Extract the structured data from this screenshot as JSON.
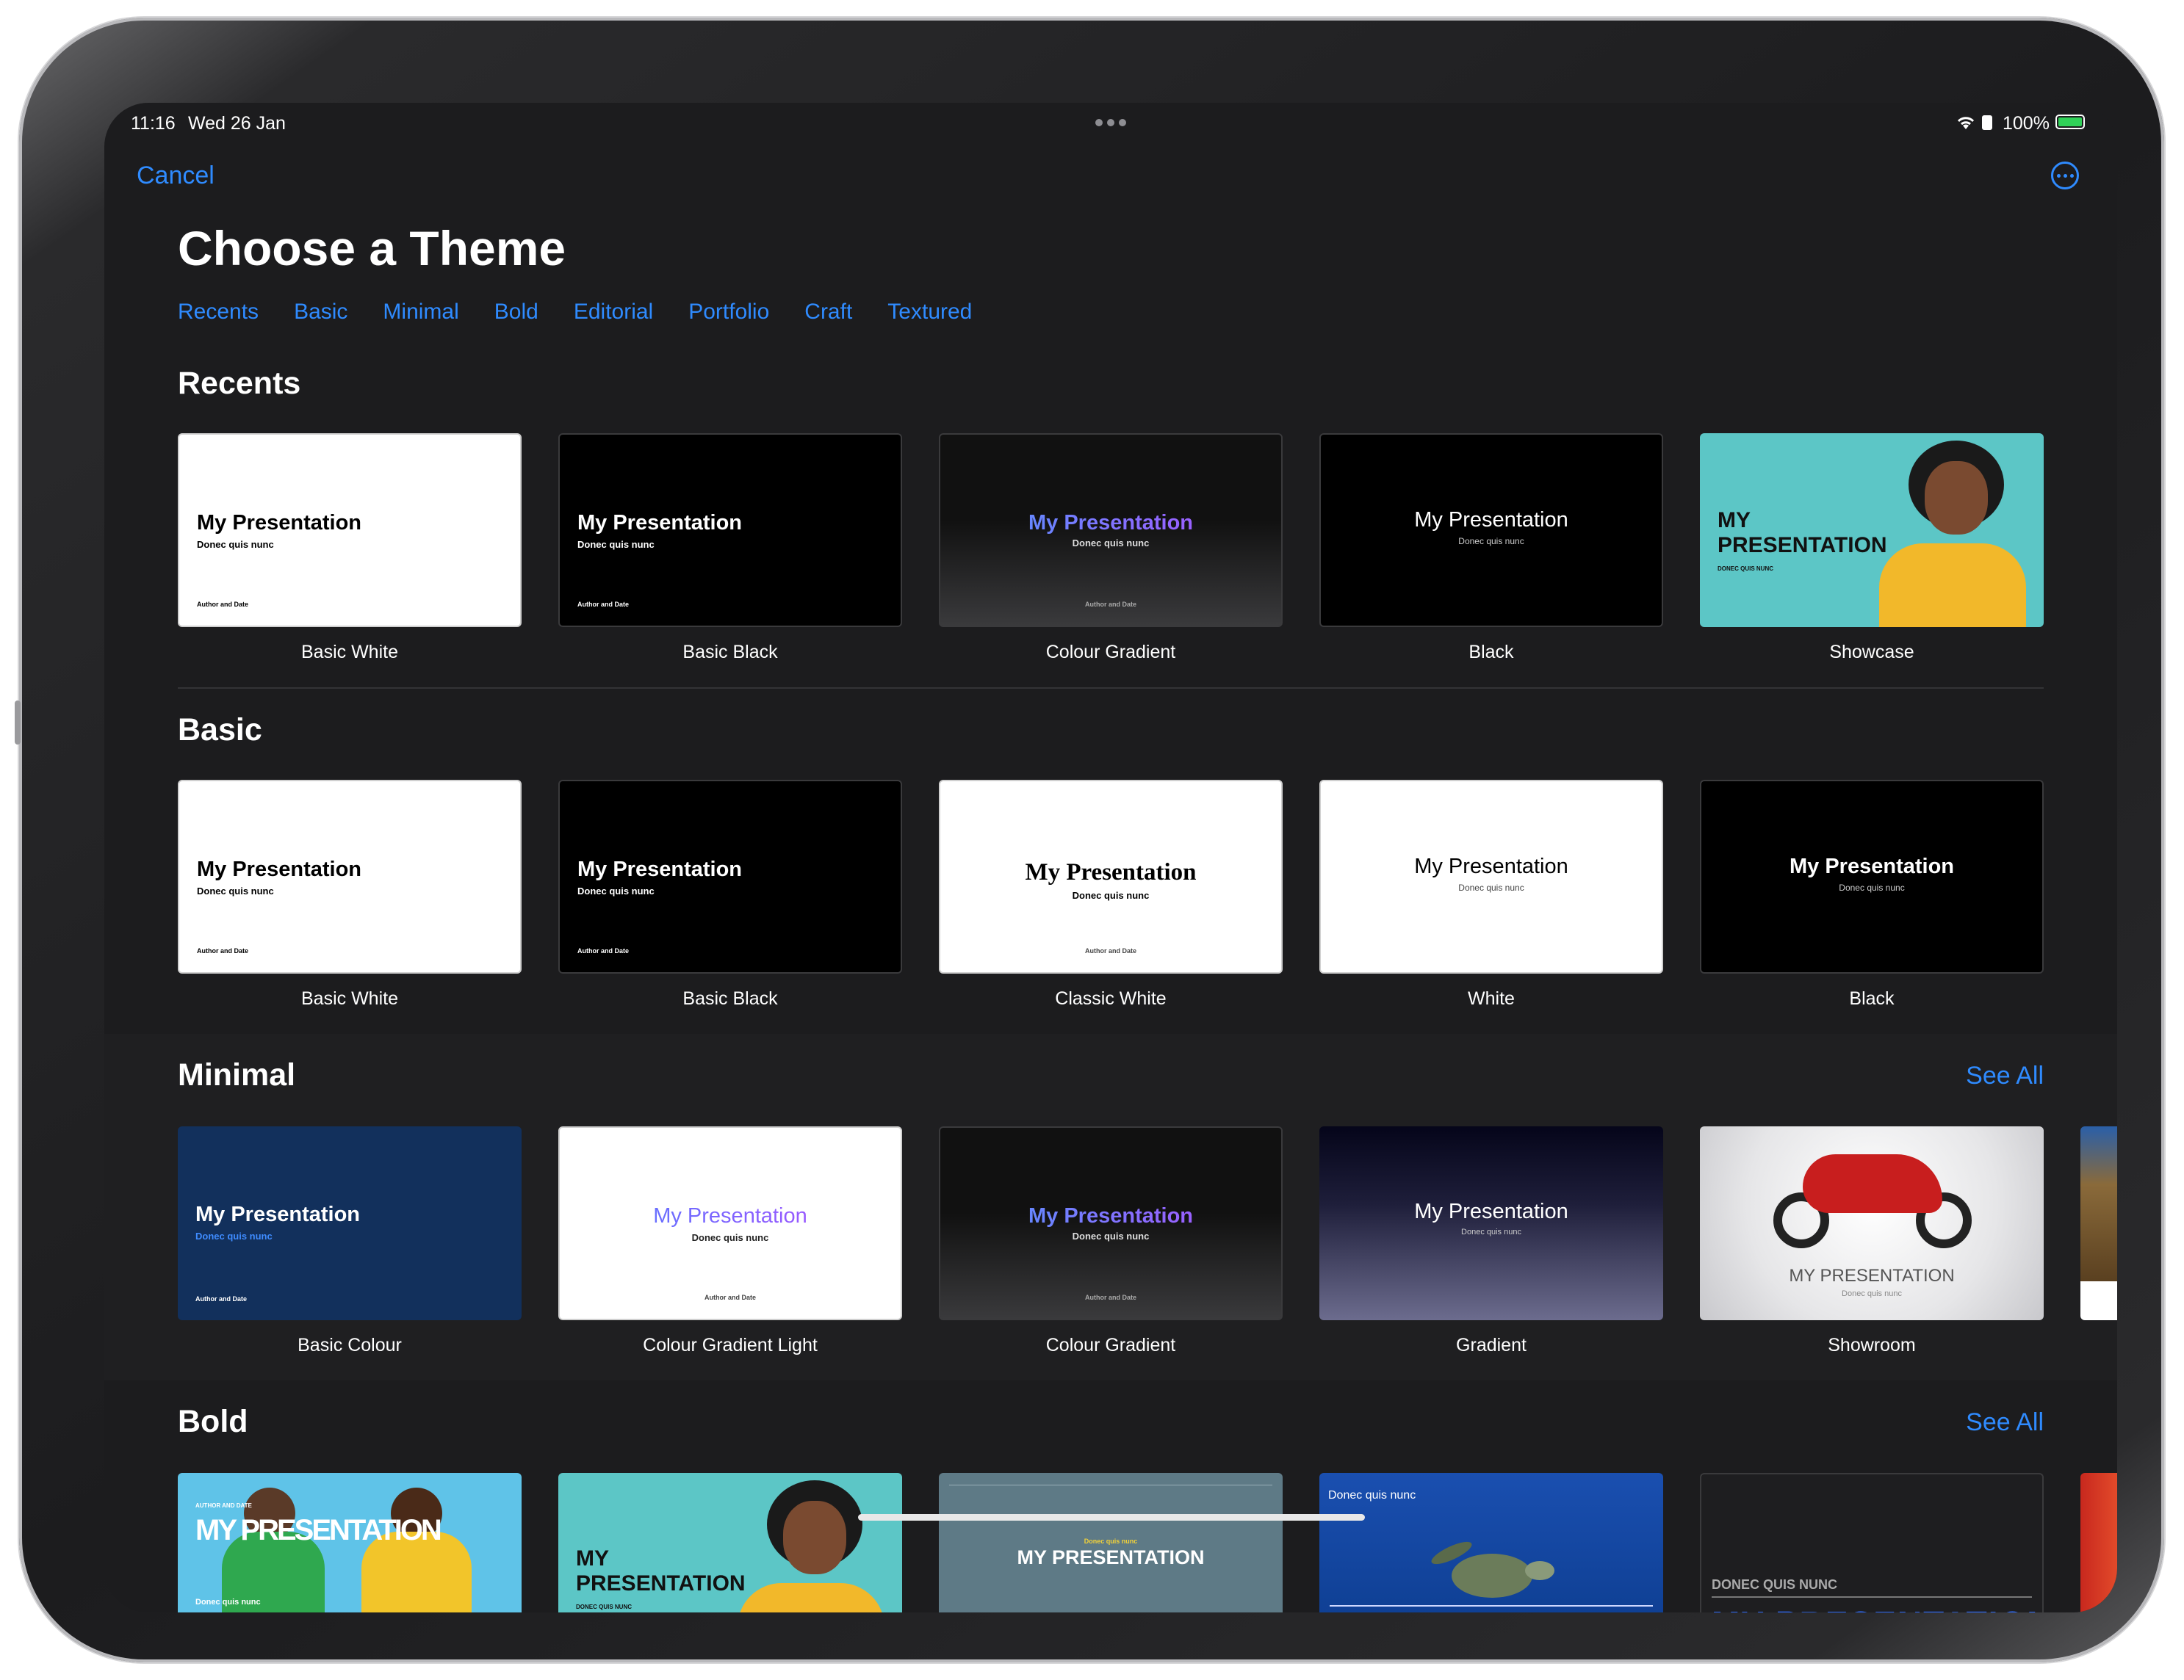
{
  "status_bar": {
    "time": "11:16",
    "date": "Wed 26 Jan",
    "battery": "100%"
  },
  "nav": {
    "cancel": "Cancel",
    "title": "Choose a Theme"
  },
  "tabs": [
    "Recents",
    "Basic",
    "Minimal",
    "Bold",
    "Editorial",
    "Portfolio",
    "Craft",
    "Textured"
  ],
  "sections": {
    "recents": {
      "title": "Recents",
      "items": [
        {
          "name": "Basic White",
          "heading": "My Presentation",
          "sub": "Donec quis nunc",
          "footer": "Author and Date"
        },
        {
          "name": "Basic Black",
          "heading": "My Presentation",
          "sub": "Donec quis nunc",
          "footer": "Author and Date"
        },
        {
          "name": "Colour Gradient",
          "heading": "My Presentation",
          "sub": "Donec quis nunc",
          "footer": "Author and Date"
        },
        {
          "name": "Black",
          "heading": "My Presentation",
          "sub": "Donec quis nunc"
        },
        {
          "name": "Showcase",
          "heading": "MY PRESENTATION",
          "sub": "DONEC QUIS NUNC"
        }
      ]
    },
    "basic": {
      "title": "Basic",
      "items": [
        {
          "name": "Basic White",
          "heading": "My Presentation",
          "sub": "Donec quis nunc",
          "footer": "Author and Date"
        },
        {
          "name": "Basic Black",
          "heading": "My Presentation",
          "sub": "Donec quis nunc",
          "footer": "Author and Date"
        },
        {
          "name": "Classic White",
          "heading": "My Presentation",
          "sub": "Donec quis nunc",
          "footer": "Author and Date"
        },
        {
          "name": "White",
          "heading": "My Presentation",
          "sub": "Donec quis nunc"
        },
        {
          "name": "Black",
          "heading": "My Presentation",
          "sub": "Donec quis nunc"
        }
      ]
    },
    "minimal": {
      "title": "Minimal",
      "see_all": "See All",
      "items": [
        {
          "name": "Basic Colour",
          "heading": "My Presentation",
          "sub": "Donec quis nunc",
          "footer": "Author and Date"
        },
        {
          "name": "Colour Gradient Light",
          "heading": "My Presentation",
          "sub": "Donec quis nunc",
          "footer": "Author and Date"
        },
        {
          "name": "Colour Gradient",
          "heading": "My Presentation",
          "sub": "Donec quis nunc",
          "footer": "Author and Date"
        },
        {
          "name": "Gradient",
          "heading": "My Presentation",
          "sub": "Donec quis nunc"
        },
        {
          "name": "Showroom",
          "heading": "MY PRESENTATION",
          "sub": "Donec quis nunc"
        }
      ]
    },
    "bold": {
      "title": "Bold",
      "see_all": "See All",
      "items": [
        {
          "heading": "MY PRESENTATION",
          "sub": "Donec quis nunc",
          "top": "AUTHOR AND DATE"
        },
        {
          "heading": "MY PRESENTATION",
          "sub": "DONEC QUIS NUNC"
        },
        {
          "heading": "MY PRESENTATION",
          "sub": "Donec quis nunc"
        },
        {
          "heading": "",
          "sub": "Donec quis nunc"
        },
        {
          "heading": "MY PRESENTATION",
          "sub": "DONEC QUIS NUNC"
        }
      ]
    }
  },
  "colors": {
    "accent": "#2f8bff",
    "background": "#1c1c1e",
    "band": "#1f1f21"
  }
}
